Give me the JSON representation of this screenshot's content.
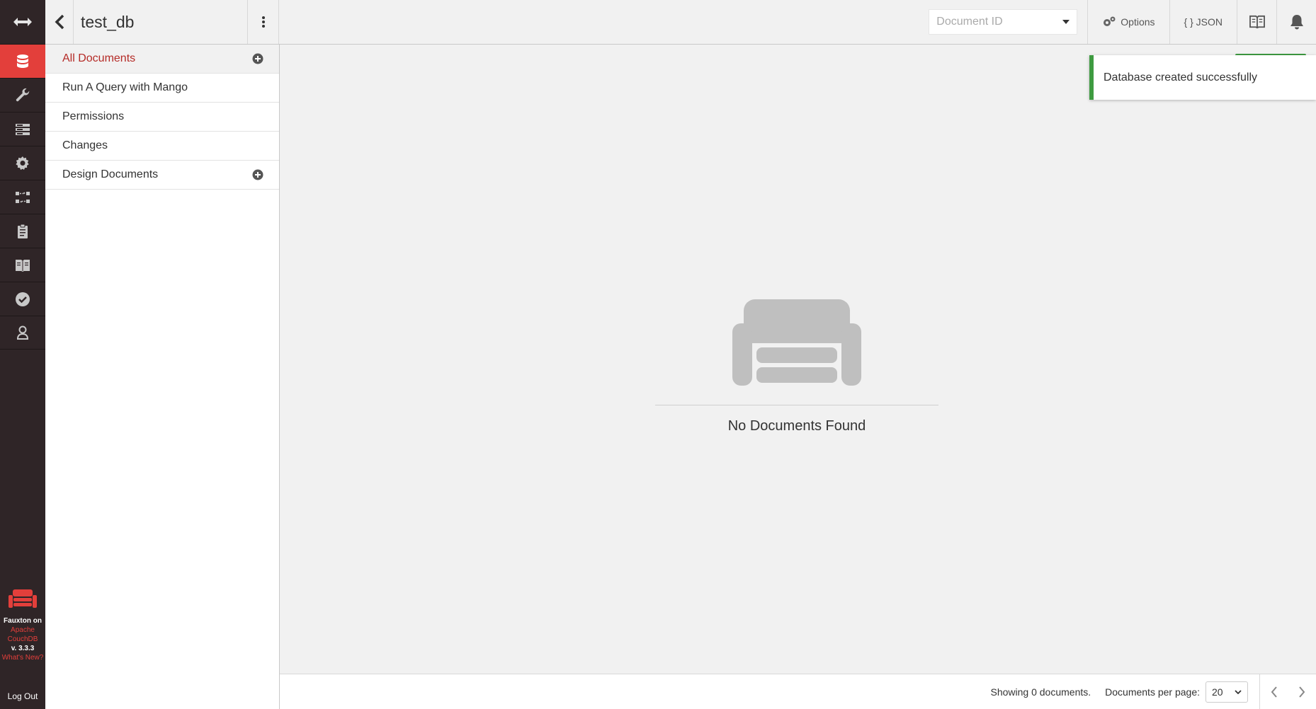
{
  "app": {
    "brand_line1": "Fauxton on",
    "brand_link1": "Apache",
    "brand_link2": "CouchDB",
    "version": "v. 3.3.3",
    "whats_new": "What's New?",
    "logout": "Log Out"
  },
  "nav": {
    "items": [
      {
        "name": "databases",
        "icon": "database-icon",
        "active": true
      },
      {
        "name": "setup",
        "icon": "wrench-icon",
        "active": false
      },
      {
        "name": "active-tasks",
        "icon": "server-icon",
        "active": false
      },
      {
        "name": "config",
        "icon": "gear-icon",
        "active": false
      },
      {
        "name": "replication",
        "icon": "replication-icon",
        "active": false
      },
      {
        "name": "logs",
        "icon": "clipboard-icon",
        "active": false
      },
      {
        "name": "documentation",
        "icon": "book-icon",
        "active": false
      },
      {
        "name": "verify",
        "icon": "check-circle-icon",
        "active": false
      },
      {
        "name": "user",
        "icon": "user-icon",
        "active": false
      }
    ]
  },
  "header": {
    "db_name": "test_db",
    "doc_id_placeholder": "Document ID",
    "options_label": "Options",
    "json_label": "{ } JSON"
  },
  "sidebar": {
    "items": [
      {
        "label": "All Documents",
        "active": true,
        "has_add": true
      },
      {
        "label": "Run A Query with Mango",
        "active": false,
        "has_add": false
      },
      {
        "label": "Permissions",
        "active": false,
        "has_add": false
      },
      {
        "label": "Changes",
        "active": false,
        "has_add": false
      },
      {
        "label": "Design Documents",
        "active": false,
        "has_add": true
      }
    ]
  },
  "main": {
    "empty_message": "No Documents Found"
  },
  "toast": {
    "message": "Database created successfully"
  },
  "footer": {
    "showing": "Showing 0 documents.",
    "per_page_label": "Documents per page:",
    "per_page_value": "20"
  },
  "colors": {
    "nav_bg": "#2f2527",
    "accent_red": "#e33f3b",
    "active_text": "#b52b27",
    "success_green": "#3e9b40"
  }
}
